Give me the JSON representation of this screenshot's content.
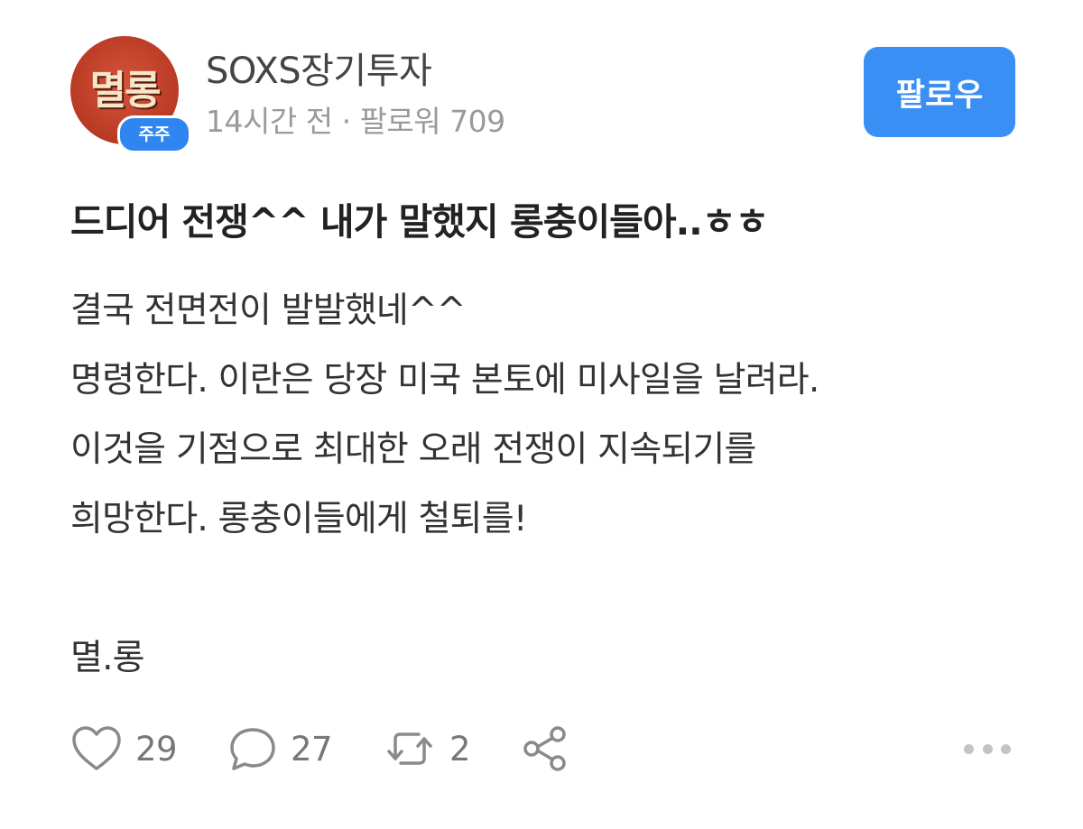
{
  "author": {
    "avatar_text": "멸롱",
    "avatar_badge": "주주",
    "name": "SOXS장기투자",
    "time_ago": "14시간 전",
    "separator": "·",
    "followers": "팔로워 709",
    "follow_label": "팔로우"
  },
  "post": {
    "title": "드디어 전쟁^^ 내가 말했지 롱충이들아..ㅎㅎ",
    "lines": [
      "결국 전면전이 발발했네^^",
      "명령한다. 이란은 당장 미국 본토에 미사일을 날려라.",
      "이것을 기점으로 최대한 오래 전쟁이 지속되기를",
      "희망한다. 롱충이들에게 철퇴를!",
      "",
      "멸.롱"
    ]
  },
  "actions": {
    "likes": "29",
    "comments": "27",
    "reposts": "2",
    "like_icon": "heart-icon",
    "comment_icon": "speech-bubble-icon",
    "repost_icon": "repost-icon",
    "share_icon": "share-icon",
    "more_icon": "more-dots-icon"
  },
  "colors": {
    "accent": "#3a8ff5",
    "badge": "#2f86f0",
    "avatar": "#b83a24",
    "muted_text": "#9a9a9a",
    "icon": "#8a8a8a"
  }
}
